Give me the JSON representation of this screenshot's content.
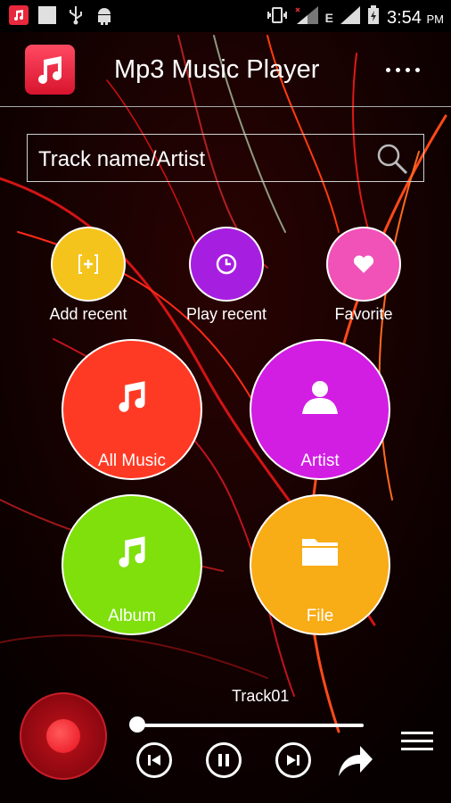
{
  "status_bar": {
    "time": "3:54",
    "ampm": "PM",
    "signal_label": "E",
    "icons": [
      "music-icon",
      "square-icon",
      "usb-icon",
      "android-icon",
      "vibrate-icon",
      "signal-icon",
      "battery-icon"
    ]
  },
  "app_bar": {
    "title": "Mp3 Music Player",
    "logo_icon": "music-note-icon",
    "menu_icon": "more-dots-icon"
  },
  "search": {
    "placeholder": "Track name/Artist",
    "icon": "search-icon"
  },
  "quick_actions": [
    {
      "label": "Add recent",
      "icon": "add-recent-icon",
      "color": "#f5c41c"
    },
    {
      "label": "Play recent",
      "icon": "clock-icon",
      "color": "#a61fe0"
    },
    {
      "label": "Favorite",
      "icon": "heart-icon",
      "color": "#f052b8"
    }
  ],
  "categories": [
    {
      "label": "All Music",
      "icon": "music-note-icon",
      "color": "#ff3a24"
    },
    {
      "label": "Artist",
      "icon": "person-icon",
      "color": "#d21de3"
    },
    {
      "label": "Album",
      "icon": "music-note-icon",
      "color": "#7fe00c"
    },
    {
      "label": "File",
      "icon": "folder-icon",
      "color": "#f8ac16"
    }
  ],
  "player": {
    "track_name": "Track01",
    "progress": 0.0,
    "buttons": [
      "previous-icon",
      "pause-icon",
      "next-icon",
      "share-icon",
      "playlist-icon"
    ]
  }
}
